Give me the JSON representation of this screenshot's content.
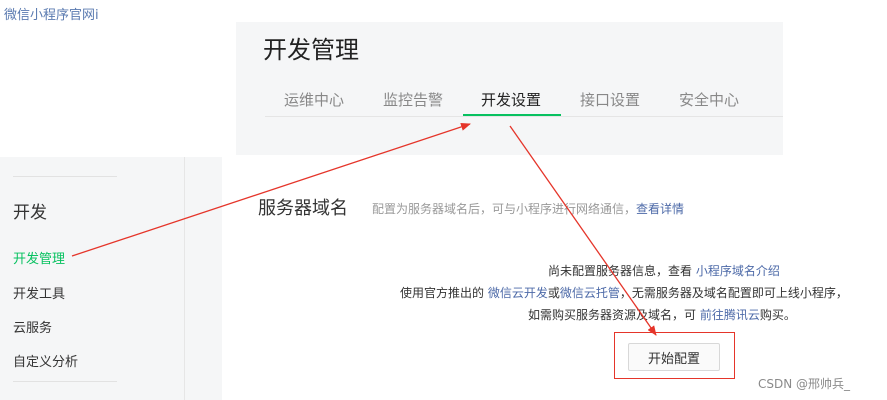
{
  "top_link": "微信小程序官网i",
  "header": {
    "title": "开发管理",
    "tabs": [
      {
        "label": "运维中心"
      },
      {
        "label": "监控告警"
      },
      {
        "label": "开发设置"
      },
      {
        "label": "接口设置"
      },
      {
        "label": "安全中心"
      }
    ],
    "active_tab_index": 2
  },
  "sidebar": {
    "heading": "开发",
    "items": [
      {
        "label": "开发管理"
      },
      {
        "label": "开发工具"
      },
      {
        "label": "云服务"
      },
      {
        "label": "自定义分析"
      }
    ],
    "active_item_index": 0
  },
  "section": {
    "title": "服务器域名",
    "desc_text": "配置为服务器域名后，可与小程序进行网络通信，",
    "desc_link": "查看详情"
  },
  "message": {
    "line1_text": "尚未配置服务器信息，查看 ",
    "line1_link": "小程序域名介绍",
    "line2_prefix": "使用官方推出的 ",
    "line2_link1": "微信云开发",
    "line2_or": "或",
    "line2_link2": "微信云托管",
    "line2_suffix": "，无需服务器及域名配置即可上线小程序，",
    "line3_prefix": "如需购买服务器资源及域名，可 ",
    "line3_link": "前往腾讯云",
    "line3_suffix": "购买。"
  },
  "start_button_label": "开始配置",
  "watermark": "CSDN @邢帅兵_",
  "colors": {
    "accent_green": "#07c160",
    "link_blue": "#4d6aa8",
    "annotation_red": "#e5352a"
  }
}
